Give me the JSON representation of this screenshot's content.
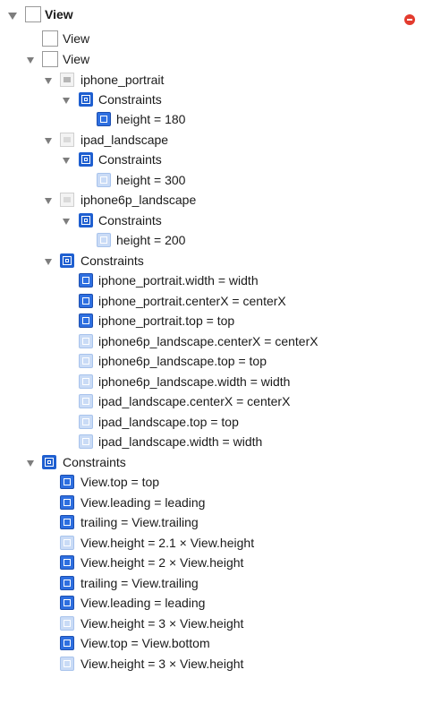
{
  "rows": [
    {
      "label": "View",
      "icon": "view",
      "bold": true,
      "disclosure": true,
      "badge": true,
      "badge_icon": "error-icon",
      "icon_name": "view-icon"
    },
    {
      "label": "View",
      "icon": "view",
      "disclosure": false,
      "icon_name": "view-icon"
    },
    {
      "label": "View",
      "icon": "view",
      "disclosure": true,
      "icon_name": "view-icon"
    },
    {
      "label": "iphone_portrait",
      "icon": "image dark",
      "disclosure": true,
      "icon_name": "image-view-icon"
    },
    {
      "label": "Constraints",
      "icon": "cgroup",
      "disclosure": true,
      "icon_name": "constraints-group-icon"
    },
    {
      "label": "height = 180",
      "icon": "constraint",
      "disclosure": false,
      "icon_name": "height-constraint-icon"
    },
    {
      "label": "ipad_landscape",
      "icon": "image",
      "disclosure": true,
      "icon_name": "image-view-icon"
    },
    {
      "label": "Constraints",
      "icon": "cgroup",
      "disclosure": true,
      "icon_name": "constraints-group-icon"
    },
    {
      "label": "height = 300",
      "icon": "constraint faded",
      "disclosure": false,
      "icon_name": "height-constraint-icon"
    },
    {
      "label": "iphone6p_landscape",
      "icon": "image",
      "disclosure": true,
      "icon_name": "image-view-icon"
    },
    {
      "label": "Constraints",
      "icon": "cgroup",
      "disclosure": true,
      "icon_name": "constraints-group-icon"
    },
    {
      "label": "height = 200",
      "icon": "constraint faded",
      "disclosure": false,
      "icon_name": "height-constraint-icon"
    },
    {
      "label": "Constraints",
      "icon": "cgroup",
      "disclosure": true,
      "icon_name": "constraints-group-icon"
    },
    {
      "label": "iphone_portrait.width = width",
      "icon": "constraint",
      "disclosure": false,
      "icon_name": "width-constraint-icon"
    },
    {
      "label": "iphone_portrait.centerX = centerX",
      "icon": "constraint",
      "disclosure": false,
      "icon_name": "center-x-constraint-icon"
    },
    {
      "label": "iphone_portrait.top = top",
      "icon": "constraint",
      "disclosure": false,
      "icon_name": "top-constraint-icon"
    },
    {
      "label": "iphone6p_landscape.centerX = centerX",
      "icon": "constraint faded",
      "disclosure": false,
      "icon_name": "center-x-constraint-icon"
    },
    {
      "label": "iphone6p_landscape.top = top",
      "icon": "constraint faded",
      "disclosure": false,
      "icon_name": "top-constraint-icon"
    },
    {
      "label": "iphone6p_landscape.width = width",
      "icon": "constraint faded",
      "disclosure": false,
      "icon_name": "width-constraint-icon"
    },
    {
      "label": "ipad_landscape.centerX = centerX",
      "icon": "constraint faded",
      "disclosure": false,
      "icon_name": "center-x-constraint-icon"
    },
    {
      "label": "ipad_landscape.top = top",
      "icon": "constraint faded",
      "disclosure": false,
      "icon_name": "top-constraint-icon"
    },
    {
      "label": "ipad_landscape.width = width",
      "icon": "constraint faded",
      "disclosure": false,
      "icon_name": "width-constraint-icon"
    },
    {
      "label": "Constraints",
      "icon": "cgroup",
      "disclosure": true,
      "icon_name": "constraints-group-icon"
    },
    {
      "label": "View.top = top",
      "icon": "constraint",
      "disclosure": false,
      "icon_name": "top-constraint-icon"
    },
    {
      "label": "View.leading = leading",
      "icon": "constraint",
      "disclosure": false,
      "icon_name": "leading-constraint-icon"
    },
    {
      "label": "trailing = View.trailing",
      "icon": "constraint",
      "disclosure": false,
      "icon_name": "trailing-constraint-icon"
    },
    {
      "label": "View.height = 2.1 × View.height",
      "icon": "constraint faded",
      "disclosure": false,
      "icon_name": "height-constraint-icon"
    },
    {
      "label": "View.height = 2 × View.height",
      "icon": "constraint",
      "disclosure": false,
      "icon_name": "height-constraint-icon"
    },
    {
      "label": "trailing = View.trailing",
      "icon": "constraint",
      "disclosure": false,
      "icon_name": "trailing-constraint-icon"
    },
    {
      "label": "View.leading = leading",
      "icon": "constraint",
      "disclosure": false,
      "icon_name": "leading-constraint-icon"
    },
    {
      "label": "View.height = 3 × View.height",
      "icon": "constraint faded",
      "disclosure": false,
      "icon_name": "height-constraint-icon"
    },
    {
      "label": "View.top = View.bottom",
      "icon": "constraint",
      "disclosure": false,
      "icon_name": "top-constraint-icon"
    },
    {
      "label": "View.height = 3 × View.height",
      "icon": "constraint faded",
      "disclosure": false,
      "icon_name": "height-constraint-icon"
    }
  ]
}
